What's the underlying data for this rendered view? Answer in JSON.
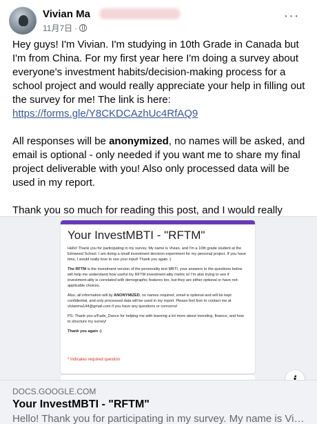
{
  "post": {
    "author": "Vivian Ma",
    "date": "11月7日",
    "separator": "·",
    "more": "···",
    "paragraph1": "Hey guys! I'm Vivian. I'm studying in 10th Grade in Canada but I'm from China. For my first year here I'm doing a survey about everyone's investment habits/decision-making process for a school project and would really appreciate your help in filling out the survey for me! The link is here: ",
    "link": "https://forms.gle/Y8CKDCAzhUc4RfAQ9",
    "paragraph2_a": "All responses will be ",
    "paragraph2_bold": "anonymized",
    "paragraph2_b": ", no names will be asked, and email is optional - only needed if you want me to share my final project deliverable with you! Also only processed data will be used in my report.",
    "paragraph3": "Thank you so much for reading this post, and I would really appreciate your help in my project!! Please message me anytime if you have any questions or concerns about it "
  },
  "form_preview": {
    "title": "Your InvestMBTI - \"RFTM\"",
    "p1": "Hello! Thank you for participating in my survey. My name is Vivian, and I'm a 10th grade student at the Elmwood School. I am doing a small investment decision experiment for my personal project. If you have time, I would really love to see your input! Thank you again :)",
    "p2_bold": "The RFTM",
    "p2": " is the investment version of the personality test MBTI, your answers to the questions below will help me understand how useful my RFTM investment-ality metric is! I'm also trying to see if investment-ality is correlated with demographic features too, but they are either optional or have not-applicable choices.",
    "p3_a": "Also, all information will by ",
    "p3_bold": "ANONYMIZED",
    "p3_b": ", no names required, email is optional and will be kept confidential, and only processed data will be used in my report. Please feel free to contact me at vivianma144@gmail.com if you have any questions or concerns!",
    "p4": "PS: Thank you u/Fade_Dance for helping me with learning a lot more about investing, finance, and how to structure my survey!",
    "p5": "Thank you again :)",
    "required_note": "* Indicates required question"
  },
  "link_preview": {
    "domain": "DOCS.GOOGLE.COM",
    "title": "Your InvestMBTI - \"RFTM\"",
    "description": "Hello! Thank you for participating in my survey. My name is Vivian, ...",
    "info": "i"
  },
  "colors": {
    "link": "#385898",
    "form_accent": "#673ab7",
    "secondary_text": "#65676b"
  },
  "icons": [
    "avatar",
    "globe-icon",
    "more-icon",
    "smile-emoji-icon",
    "info-icon"
  ]
}
